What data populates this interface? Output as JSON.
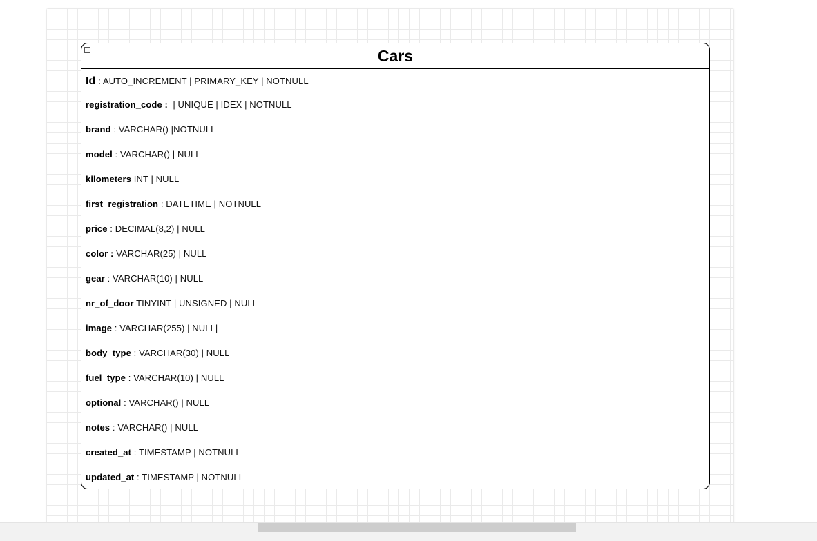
{
  "table": {
    "title": "Cars",
    "fields": [
      {
        "name": "Id",
        "sep": " : ",
        "spec": "AUTO_INCREMENT | PRIMARY_KEY | NOTNULL"
      },
      {
        "name": "registration_code :",
        "sep": " ",
        "spec": " | UNIQUE | IDEX | NOTNULL"
      },
      {
        "name": "brand",
        "sep": " : ",
        "spec": "VARCHAR() |NOTNULL"
      },
      {
        "name": "model",
        "sep": " : ",
        "spec": "VARCHAR() | NULL"
      },
      {
        "name": "kilometers",
        "sep": " ",
        "spec": "INT | NULL"
      },
      {
        "name": "first_registration",
        "sep": " : ",
        "spec": "DATETIME | NOTNULL"
      },
      {
        "name": "price",
        "sep": " : ",
        "spec": "DECIMAL(8,2) | NULL"
      },
      {
        "name": "color :",
        "sep": " ",
        "spec": "VARCHAR(25) | NULL"
      },
      {
        "name": "gear",
        "sep": " : ",
        "spec": "VARCHAR(10) | NULL"
      },
      {
        "name": "nr_of_door",
        "sep": " ",
        "spec": "TINYINT | UNSIGNED | NULL"
      },
      {
        "name": "image",
        "sep": " : ",
        "spec": "VARCHAR(255) | NULL|"
      },
      {
        "name": "body_type",
        "sep": " : ",
        "spec": "VARCHAR(30) | NULL"
      },
      {
        "name": "fuel_type",
        "sep": " : ",
        "spec": "VARCHAR(10) | NULL"
      },
      {
        "name": "optional",
        "sep": " : ",
        "spec": "VARCHAR() | NULL"
      },
      {
        "name": "notes",
        "sep": " : ",
        "spec": "VARCHAR() | NULL"
      },
      {
        "name": "created_at",
        "sep": " : ",
        "spec": "TIMESTAMP | NOTNULL"
      },
      {
        "name": "updated_at",
        "sep": " : ",
        "spec": "TIMESTAMP | NOTNULL"
      }
    ]
  }
}
